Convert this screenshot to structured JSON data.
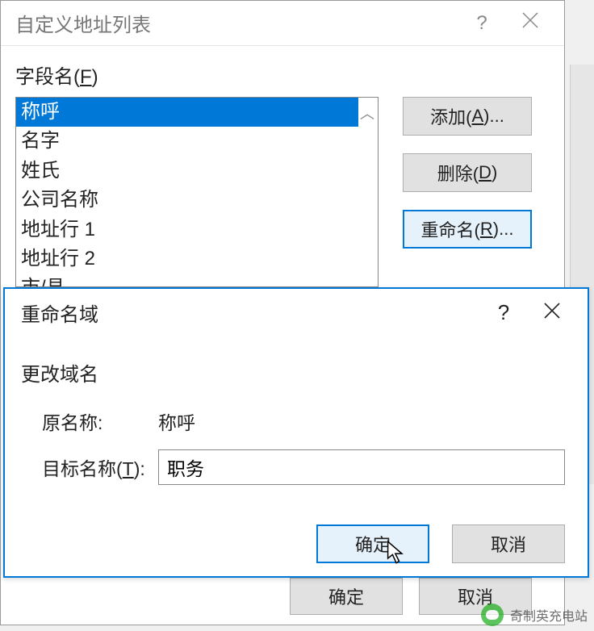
{
  "main_dialog": {
    "title": "自定义地址列表",
    "help": "?",
    "field_label_prefix": "字段名(",
    "field_label_accel": "F",
    "field_label_suffix": ")",
    "list_items": [
      "称呼",
      "名字",
      "姓氏",
      "公司名称",
      "地址行 1",
      "地址行 2",
      "市/县"
    ],
    "selected_index": 0,
    "buttons": {
      "add_prefix": "添加(",
      "add_accel": "A",
      "add_suffix": ")...",
      "delete_prefix": "删除(",
      "delete_accel": "D",
      "delete_suffix": ")",
      "rename_prefix": "重命名(",
      "rename_accel": "R",
      "rename_suffix": ")..."
    },
    "footer": {
      "ok": "确定",
      "cancel": "取消"
    }
  },
  "rename_dialog": {
    "title": "重命名域",
    "help": "?",
    "section_label": "更改域名",
    "original_label": "原名称:",
    "original_value": "称呼",
    "target_label_prefix": "目标名称(",
    "target_label_accel": "T",
    "target_label_suffix": "):",
    "target_value": "职务",
    "ok": "确定",
    "cancel": "取消"
  },
  "watermark": "奇制英充电站"
}
